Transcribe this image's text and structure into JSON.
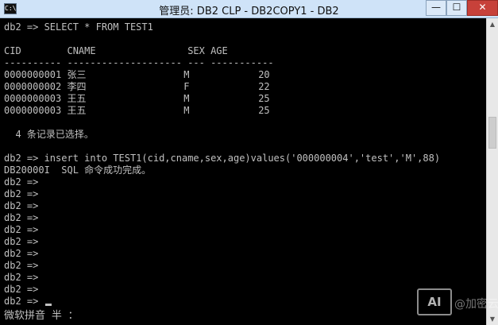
{
  "window": {
    "title": "管理员: DB2 CLP - DB2COPY1 - DB2",
    "icon_label": "C:\\",
    "min_glyph": "—",
    "max_glyph": "☐",
    "close_glyph": "✕"
  },
  "console": {
    "lines": [
      "db2 => SELECT * FROM TEST1",
      "",
      "CID        CNAME                SEX AGE",
      "---------- -------------------- --- -----------",
      "0000000001 张三                 M            20",
      "0000000002 李四                 F            22",
      "0000000003 王五                 M            25",
      "0000000003 王五                 M            25",
      "",
      "  4 条记录已选择。",
      "",
      "db2 => insert into TEST1(cid,cname,sex,age)values('000000004','test','M',88)",
      "DB20000I  SQL 命令成功完成。",
      "db2 =>",
      "db2 =>",
      "db2 =>",
      "db2 =>",
      "db2 =>",
      "db2 =>",
      "db2 =>",
      "db2 =>",
      "db2 =>",
      "db2 =>",
      "db2 =>",
      "db2 =>"
    ],
    "ime_status": "微软拼音 半 ："
  },
  "watermark": {
    "logo": "AI",
    "text": "@加密云"
  },
  "icons": [
    "console-icon",
    "minimize-icon",
    "maximize-icon",
    "close-icon"
  ],
  "colors": {
    "console_bg": "#000000",
    "console_fg": "#c0c0c0",
    "titlebar_bg": "#cfe3f8",
    "close_bg": "#c7413a"
  }
}
